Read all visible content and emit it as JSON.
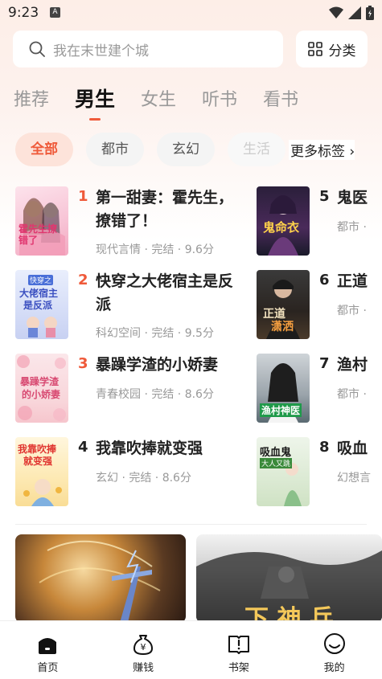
{
  "status": {
    "time": "9:23",
    "a_badge": "A"
  },
  "search": {
    "placeholder": "我在末世建个城"
  },
  "category_button": {
    "label": "分类"
  },
  "tabs": [
    {
      "label": "推荐"
    },
    {
      "label": "男生"
    },
    {
      "label": "女生"
    },
    {
      "label": "听书"
    },
    {
      "label": "看书"
    }
  ],
  "chips": [
    {
      "label": "全部"
    },
    {
      "label": "都市"
    },
    {
      "label": "玄幻"
    },
    {
      "label": "生活"
    }
  ],
  "more_tags": {
    "label": "更多标签 ›"
  },
  "books_left": [
    {
      "rank": "1",
      "title": "第一甜妻：霍先生，",
      "title2": "撩错了！",
      "meta": "现代言情 · 完结 · 9.6分"
    },
    {
      "rank": "2",
      "title": "快穿之大佬宿主是反",
      "title2": "派",
      "meta": "科幻空间 · 完结 · 9.5分"
    },
    {
      "rank": "3",
      "title": "暴躁学渣的小娇妻",
      "meta": "青春校园 · 完结 · 8.6分"
    },
    {
      "rank": "4",
      "title": "我靠吹捧就变强",
      "meta": "玄幻 · 完结 · 8.6分"
    }
  ],
  "books_right": [
    {
      "rank": "5",
      "title": "鬼医",
      "meta": "都市 ·"
    },
    {
      "rank": "6",
      "title": "正道",
      "meta": "都市 ·"
    },
    {
      "rank": "7",
      "title": "渔村",
      "meta": "都市 ·"
    },
    {
      "rank": "8",
      "title": "吸血",
      "meta": "幻想言"
    }
  ],
  "covers": {
    "c1": "霍先生撩错了",
    "c2a": "快穿之",
    "c2b": "大佬宿主",
    "c2c": "是反派",
    "c3a": "暴躁学渣",
    "c3b": "的小娇妻",
    "c4a": "我靠吹捧",
    "c4b": "就变强",
    "c5": "鬼命衣",
    "c6a": "正道",
    "c6b": "潇洒",
    "c7": "渔村神医",
    "c8a": "吸血鬼",
    "c8b": "大人又跳"
  },
  "banner2_text": "下 神 兵",
  "bottom_nav": [
    {
      "label": "首页",
      "icon": "home-icon"
    },
    {
      "label": "赚钱",
      "icon": "money-bag-icon"
    },
    {
      "label": "书架",
      "icon": "bookshelf-icon"
    },
    {
      "label": "我的",
      "icon": "profile-icon"
    }
  ],
  "colors": {
    "accent": "#ef5a3a",
    "chip_active_bg": "#fde3da"
  }
}
